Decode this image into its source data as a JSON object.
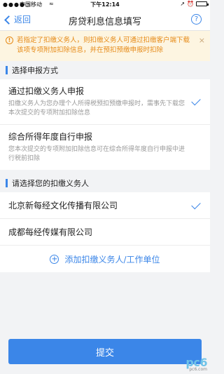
{
  "status_bar": {
    "signal": "●●●●○",
    "carrier": "中国移动",
    "wifi": "≈",
    "time": "下午12:14",
    "location_icon": "↗",
    "alarm_icon": "⏰"
  },
  "nav": {
    "back_label": "返回",
    "title": "房贷利息信息填写",
    "help_label": "?"
  },
  "notice": {
    "text": "若指定了扣缴义务人，则扣缴义务人可通过扣缴客户端下载该项专项附加扣除信息，并在预扣预缴申报时扣除",
    "icon": "!",
    "close": "×"
  },
  "section_method": {
    "title": "选择申报方式",
    "options": [
      {
        "title": "通过扣缴义务人申报",
        "desc": "扣缴义务人为您办理个人所得税预扣预缴申报时，需事先下载您本次提交的专项附加扣除信息",
        "selected": true
      },
      {
        "title": "综合所得年度自行申报",
        "desc": "您本次提交的专项附加扣除信息可在综合所得年度自行申报中进行税前扣除",
        "selected": false
      }
    ]
  },
  "section_agent": {
    "title": "请选择您的扣缴义务人",
    "agents": [
      {
        "name": "北京新每经文化传播有限公司",
        "selected": true
      },
      {
        "name": "成都每经传媒有限公司",
        "selected": false
      }
    ],
    "add_label": "添加扣缴义务人/工作单位"
  },
  "submit_label": "提交",
  "watermark": {
    "main": "pc6",
    "sub": "pc6.com"
  },
  "colors": {
    "accent": "#3b86e8",
    "notice_bg": "#fdf5e1",
    "notice_text": "#e68a16"
  }
}
